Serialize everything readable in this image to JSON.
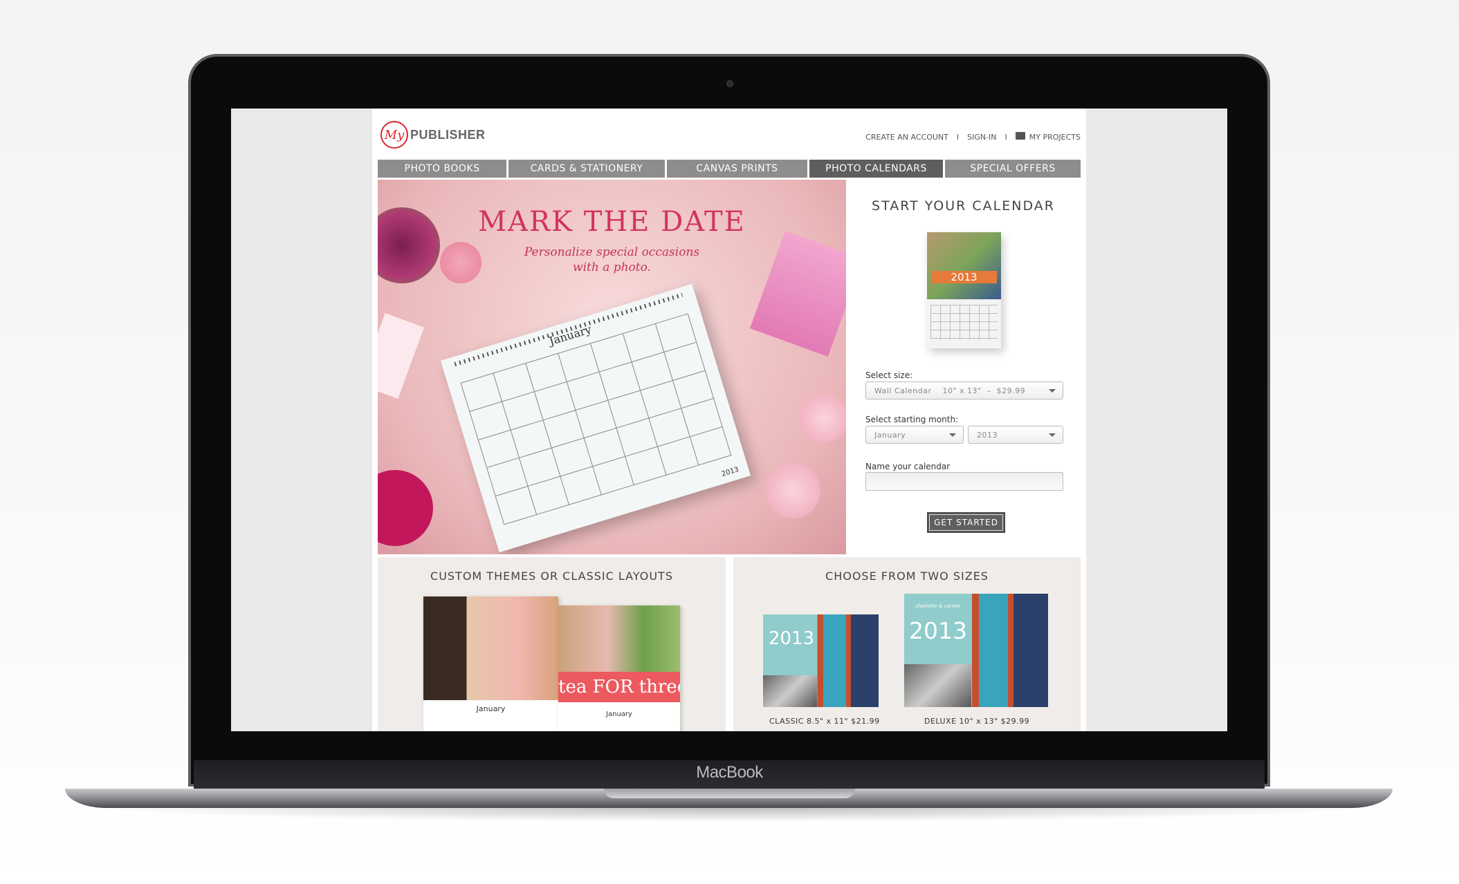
{
  "device": {
    "brand": "MacBook"
  },
  "header": {
    "logo_my": "My",
    "logo_text": "PUBLISHER",
    "links": [
      "CREATE AN ACCOUNT",
      "SIGN-IN",
      "MY PROJECTS"
    ],
    "separator": "I"
  },
  "nav": {
    "items": [
      "PHOTO BOOKS",
      "CARDS & STATIONERY",
      "CANVAS PRINTS",
      "PHOTO CALENDARS",
      "SPECIAL OFFERS"
    ],
    "active": "PHOTO CALENDARS"
  },
  "hero": {
    "title": "MARK THE DATE",
    "subtitle_line1": "Personalize special occasions",
    "subtitle_line2": "with a photo.",
    "calendar_month": "January",
    "calendar_year": "2013"
  },
  "form": {
    "title": "START YOUR CALENDAR",
    "thumb_year": "2013",
    "size_label": "Select size:",
    "size_value": "Wall Calendar    10\" x 13\"  –  $29.99",
    "month_label": "Select starting month:",
    "month_value": "January",
    "year_value": "2013",
    "name_label": "Name your calendar",
    "name_value": "",
    "button": "GET STARTED"
  },
  "features": {
    "themes": {
      "title": "CUSTOM THEMES OR CLASSIC LAYOUTS",
      "banner": "tea FOR three",
      "month": "January"
    },
    "sizes": {
      "title": "CHOOSE FROM TWO SIZES",
      "year": "2013",
      "names": "charlotte & conner",
      "classic": "CLASSIC  8.5\" x 11\"  $21.99",
      "deluxe": "DELUXE  10\" x 13\"  $29.99"
    }
  },
  "colors": {
    "brand_red": "#d9262c",
    "nav_gray": "#8d8d8d",
    "nav_active": "#5e5e5e",
    "hero_pink": "#d1345b",
    "teal": "#8fcccb"
  }
}
